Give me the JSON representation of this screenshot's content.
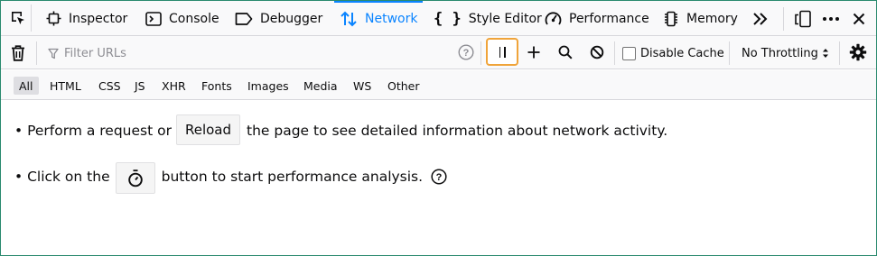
{
  "tabs": [
    {
      "label": "Inspector",
      "icon": "inspector-icon"
    },
    {
      "label": "Console",
      "icon": "console-icon"
    },
    {
      "label": "Debugger",
      "icon": "debugger-icon"
    },
    {
      "label": "Network",
      "icon": "network-icon",
      "selected": true
    },
    {
      "label": "Style Editor",
      "icon": "style-editor-icon"
    },
    {
      "label": "Performance",
      "icon": "performance-icon"
    },
    {
      "label": "Memory",
      "icon": "memory-icon"
    }
  ],
  "toolbar": {
    "filter_placeholder": "Filter URLs",
    "disable_cache_label": "Disable Cache",
    "disable_cache_checked": false,
    "throttling_label": "No Throttling"
  },
  "type_filters": [
    {
      "label": "All",
      "active": true
    },
    {
      "label": "HTML"
    },
    {
      "label": "CSS"
    },
    {
      "label": "JS"
    },
    {
      "label": "XHR"
    },
    {
      "label": "Fonts"
    },
    {
      "label": "Images"
    },
    {
      "label": "Media"
    },
    {
      "label": "WS"
    },
    {
      "label": "Other"
    }
  ],
  "notice": {
    "line1_prefix": "• Perform a request or",
    "reload_button": "Reload",
    "line1_suffix": "the page to see detailed information about network activity.",
    "line2_prefix": "• Click on the",
    "line2_suffix": "button to start performance analysis."
  },
  "colors": {
    "accent": "#0a84ff",
    "highlight_border": "#f0a43a",
    "frame_border": "#2a8a6e"
  }
}
